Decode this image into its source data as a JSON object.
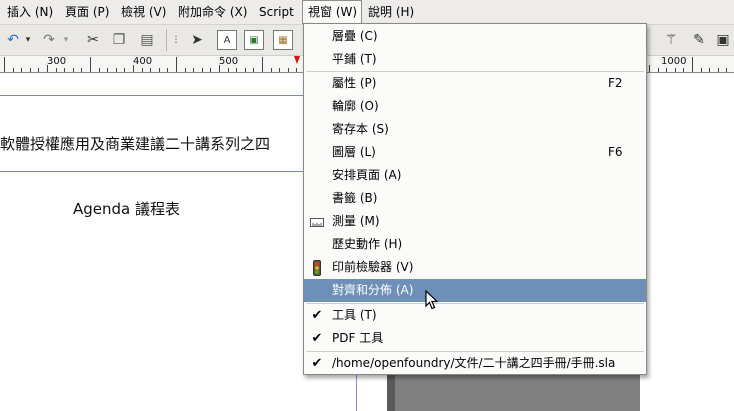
{
  "menubar": {
    "items": [
      "插入 (N)",
      "頁面 (P)",
      "檢視 (V)",
      "附加命令 (X)",
      "Script",
      "視窗 (W)",
      "說明 (H)"
    ],
    "open_index": 5
  },
  "ruler": {
    "labels": [
      "300",
      "400",
      "500",
      "1000"
    ]
  },
  "document": {
    "title_line": "軟體授權應用及商業建議二十講系列之四",
    "agenda": "Agenda 議程表"
  },
  "window_menu": {
    "items": [
      {
        "label": "層疊 (C)",
        "shortcut": "",
        "icon": "",
        "checked": false
      },
      {
        "label": "平鋪 (T)",
        "shortcut": "",
        "icon": "",
        "checked": false
      },
      {
        "label": "屬性 (P)",
        "shortcut": "F2",
        "icon": "",
        "checked": false
      },
      {
        "label": "輪廓 (O)",
        "shortcut": "",
        "icon": "",
        "checked": false
      },
      {
        "label": "寄存本 (S)",
        "shortcut": "",
        "icon": "",
        "checked": false
      },
      {
        "label": "圖層 (L)",
        "shortcut": "F6",
        "icon": "",
        "checked": false
      },
      {
        "label": "安排頁面 (A)",
        "shortcut": "",
        "icon": "",
        "checked": false
      },
      {
        "label": "書籤 (B)",
        "shortcut": "",
        "icon": "",
        "checked": false
      },
      {
        "label": "測量 (M)",
        "shortcut": "",
        "icon": "ruler-icon",
        "checked": false
      },
      {
        "label": "歷史動作 (H)",
        "shortcut": "",
        "icon": "",
        "checked": false
      },
      {
        "label": "印前檢驗器 (V)",
        "shortcut": "",
        "icon": "traffic-light-icon",
        "checked": false
      },
      {
        "label": "對齊和分佈 (A)",
        "shortcut": "",
        "icon": "",
        "checked": false
      },
      {
        "label": "工具 (T)",
        "shortcut": "",
        "icon": "",
        "checked": true
      },
      {
        "label": "PDF 工具",
        "shortcut": "",
        "icon": "",
        "checked": true
      },
      {
        "label": "/home/openfoundry/文件/二十講之四手冊/手冊.sla",
        "shortcut": "",
        "icon": "",
        "checked": true
      }
    ],
    "highlighted_index": 11
  },
  "colors": {
    "highlight": "#6d8fb8",
    "menu_bg": "#fbfbfa",
    "canvas_bg": "#808080"
  }
}
